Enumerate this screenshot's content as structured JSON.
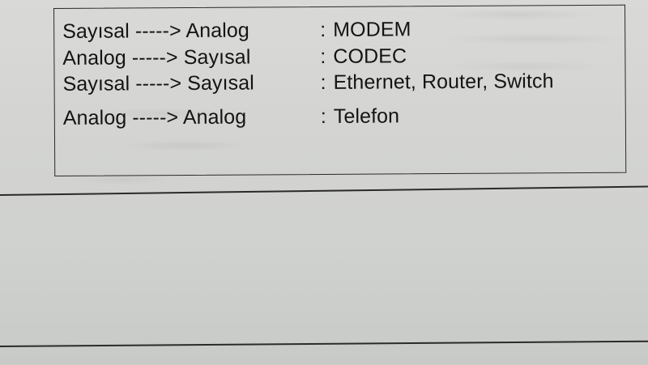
{
  "conversion_table": {
    "rows": [
      {
        "from_to": "Sayısal -----> Analog",
        "colon": ":",
        "device": "MODEM"
      },
      {
        "from_to": "Analog -----> Sayısal",
        "colon": ":",
        "device": "CODEC"
      },
      {
        "from_to": "Sayısal -----> Sayısal",
        "colon": ":",
        "device": "Ethernet, Router, Switch"
      },
      {
        "from_to": "Analog -----> Analog",
        "colon": ":",
        "device": "Telefon"
      }
    ]
  }
}
